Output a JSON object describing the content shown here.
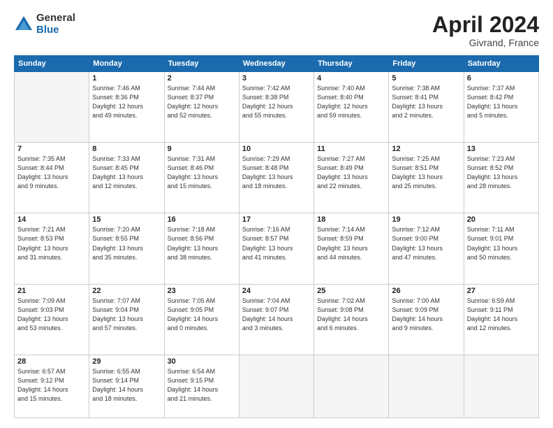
{
  "logo": {
    "general": "General",
    "blue": "Blue"
  },
  "title": {
    "month_year": "April 2024",
    "location": "Givrand, France"
  },
  "weekdays": [
    "Sunday",
    "Monday",
    "Tuesday",
    "Wednesday",
    "Thursday",
    "Friday",
    "Saturday"
  ],
  "weeks": [
    [
      {
        "day": "",
        "info": ""
      },
      {
        "day": "1",
        "info": "Sunrise: 7:46 AM\nSunset: 8:36 PM\nDaylight: 12 hours\nand 49 minutes."
      },
      {
        "day": "2",
        "info": "Sunrise: 7:44 AM\nSunset: 8:37 PM\nDaylight: 12 hours\nand 52 minutes."
      },
      {
        "day": "3",
        "info": "Sunrise: 7:42 AM\nSunset: 8:38 PM\nDaylight: 12 hours\nand 55 minutes."
      },
      {
        "day": "4",
        "info": "Sunrise: 7:40 AM\nSunset: 8:40 PM\nDaylight: 12 hours\nand 59 minutes."
      },
      {
        "day": "5",
        "info": "Sunrise: 7:38 AM\nSunset: 8:41 PM\nDaylight: 13 hours\nand 2 minutes."
      },
      {
        "day": "6",
        "info": "Sunrise: 7:37 AM\nSunset: 8:42 PM\nDaylight: 13 hours\nand 5 minutes."
      }
    ],
    [
      {
        "day": "7",
        "info": "Sunrise: 7:35 AM\nSunset: 8:44 PM\nDaylight: 13 hours\nand 9 minutes."
      },
      {
        "day": "8",
        "info": "Sunrise: 7:33 AM\nSunset: 8:45 PM\nDaylight: 13 hours\nand 12 minutes."
      },
      {
        "day": "9",
        "info": "Sunrise: 7:31 AM\nSunset: 8:46 PM\nDaylight: 13 hours\nand 15 minutes."
      },
      {
        "day": "10",
        "info": "Sunrise: 7:29 AM\nSunset: 8:48 PM\nDaylight: 13 hours\nand 18 minutes."
      },
      {
        "day": "11",
        "info": "Sunrise: 7:27 AM\nSunset: 8:49 PM\nDaylight: 13 hours\nand 22 minutes."
      },
      {
        "day": "12",
        "info": "Sunrise: 7:25 AM\nSunset: 8:51 PM\nDaylight: 13 hours\nand 25 minutes."
      },
      {
        "day": "13",
        "info": "Sunrise: 7:23 AM\nSunset: 8:52 PM\nDaylight: 13 hours\nand 28 minutes."
      }
    ],
    [
      {
        "day": "14",
        "info": "Sunrise: 7:21 AM\nSunset: 8:53 PM\nDaylight: 13 hours\nand 31 minutes."
      },
      {
        "day": "15",
        "info": "Sunrise: 7:20 AM\nSunset: 8:55 PM\nDaylight: 13 hours\nand 35 minutes."
      },
      {
        "day": "16",
        "info": "Sunrise: 7:18 AM\nSunset: 8:56 PM\nDaylight: 13 hours\nand 38 minutes."
      },
      {
        "day": "17",
        "info": "Sunrise: 7:16 AM\nSunset: 8:57 PM\nDaylight: 13 hours\nand 41 minutes."
      },
      {
        "day": "18",
        "info": "Sunrise: 7:14 AM\nSunset: 8:59 PM\nDaylight: 13 hours\nand 44 minutes."
      },
      {
        "day": "19",
        "info": "Sunrise: 7:12 AM\nSunset: 9:00 PM\nDaylight: 13 hours\nand 47 minutes."
      },
      {
        "day": "20",
        "info": "Sunrise: 7:11 AM\nSunset: 9:01 PM\nDaylight: 13 hours\nand 50 minutes."
      }
    ],
    [
      {
        "day": "21",
        "info": "Sunrise: 7:09 AM\nSunset: 9:03 PM\nDaylight: 13 hours\nand 53 minutes."
      },
      {
        "day": "22",
        "info": "Sunrise: 7:07 AM\nSunset: 9:04 PM\nDaylight: 13 hours\nand 57 minutes."
      },
      {
        "day": "23",
        "info": "Sunrise: 7:05 AM\nSunset: 9:05 PM\nDaylight: 14 hours\nand 0 minutes."
      },
      {
        "day": "24",
        "info": "Sunrise: 7:04 AM\nSunset: 9:07 PM\nDaylight: 14 hours\nand 3 minutes."
      },
      {
        "day": "25",
        "info": "Sunrise: 7:02 AM\nSunset: 9:08 PM\nDaylight: 14 hours\nand 6 minutes."
      },
      {
        "day": "26",
        "info": "Sunrise: 7:00 AM\nSunset: 9:09 PM\nDaylight: 14 hours\nand 9 minutes."
      },
      {
        "day": "27",
        "info": "Sunrise: 6:59 AM\nSunset: 9:11 PM\nDaylight: 14 hours\nand 12 minutes."
      }
    ],
    [
      {
        "day": "28",
        "info": "Sunrise: 6:57 AM\nSunset: 9:12 PM\nDaylight: 14 hours\nand 15 minutes."
      },
      {
        "day": "29",
        "info": "Sunrise: 6:55 AM\nSunset: 9:14 PM\nDaylight: 14 hours\nand 18 minutes."
      },
      {
        "day": "30",
        "info": "Sunrise: 6:54 AM\nSunset: 9:15 PM\nDaylight: 14 hours\nand 21 minutes."
      },
      {
        "day": "",
        "info": ""
      },
      {
        "day": "",
        "info": ""
      },
      {
        "day": "",
        "info": ""
      },
      {
        "day": "",
        "info": ""
      }
    ]
  ]
}
